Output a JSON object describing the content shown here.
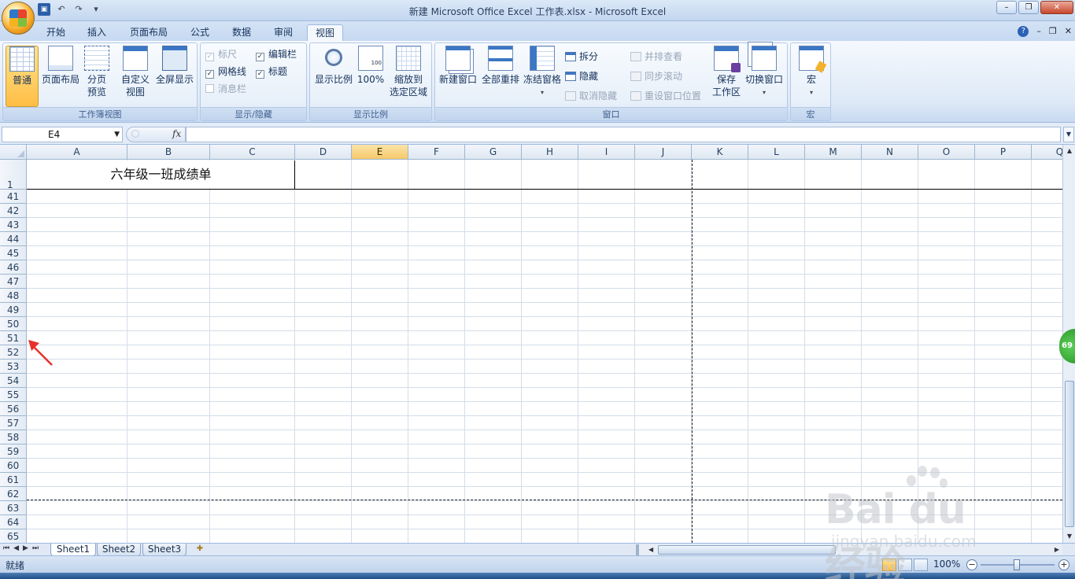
{
  "window": {
    "title": "新建 Microsoft Office Excel 工作表.xlsx - Microsoft Excel",
    "controls": [
      "–",
      "❐",
      "✕"
    ]
  },
  "qat": {
    "undo": "↶",
    "redo": "↷",
    "customize": "▾"
  },
  "tabs": [
    {
      "label": "开始",
      "active": false
    },
    {
      "label": "插入",
      "active": false
    },
    {
      "label": "页面布局",
      "active": false
    },
    {
      "label": "公式",
      "active": false
    },
    {
      "label": "数据",
      "active": false
    },
    {
      "label": "审阅",
      "active": false
    },
    {
      "label": "视图",
      "active": true
    }
  ],
  "tab_controls": {
    "help": "?",
    "min": "–",
    "restore": "❐",
    "close": "✕"
  },
  "ribbon": {
    "workbook_views": {
      "label": "工作簿视图",
      "normal": "普通",
      "page_layout": "页面布局",
      "page_break_1": "分页",
      "page_break_2": "预览",
      "custom_1": "自定义",
      "custom_2": "视图",
      "fullscreen": "全屏显示"
    },
    "show_hide": {
      "label": "显示/隐藏",
      "ruler": "标尺",
      "gridlines": "网格线",
      "message_bar": "消息栏",
      "formula_bar": "编辑栏",
      "headings": "标题"
    },
    "zoom": {
      "label": "显示比例",
      "zoom": "显示比例",
      "hundred": "100%",
      "selection_1": "缩放到",
      "selection_2": "选定区域"
    },
    "window": {
      "label": "窗口",
      "new_window": "新建窗口",
      "arrange_all": "全部重排",
      "freeze": "冻结窗格",
      "split": "拆分",
      "hide": "隐藏",
      "unhide": "取消隐藏",
      "side_by_side": "并排查看",
      "sync_scroll": "同步滚动",
      "reset_position": "重设窗口位置",
      "save_workspace_1": "保存",
      "save_workspace_2": "工作区",
      "switch_windows": "切换窗口"
    },
    "macros": {
      "label": "宏",
      "macro": "宏"
    }
  },
  "formula_bar": {
    "name_box": "E4",
    "fx": "fx",
    "value": ""
  },
  "columns": [
    "A",
    "B",
    "C",
    "D",
    "E",
    "F",
    "G",
    "H",
    "I",
    "J",
    "K",
    "L",
    "M",
    "N",
    "O",
    "P",
    "Q"
  ],
  "selected_column": "E",
  "rows": [
    "1",
    "41",
    "42",
    "43",
    "44",
    "45",
    "46",
    "47",
    "48",
    "49",
    "50",
    "51",
    "52",
    "53",
    "54",
    "55",
    "56",
    "57",
    "58",
    "59",
    "60",
    "61",
    "62",
    "63",
    "64",
    "65"
  ],
  "cells": {
    "title": "六年级一班成绩单"
  },
  "sheets": [
    {
      "name": "Sheet1",
      "active": true
    },
    {
      "name": "Sheet2",
      "active": false
    },
    {
      "name": "Sheet3",
      "active": false
    }
  ],
  "status": {
    "ready": "就绪",
    "zoom": "100%"
  },
  "side_badge": "69",
  "watermark": {
    "brand": "Bai du 经验",
    "url": "jingyan.baidu.com"
  },
  "colors": {
    "accent": "#ffbd45",
    "ribbon": "#dde9f7",
    "header_selected": "#f6c86a"
  }
}
